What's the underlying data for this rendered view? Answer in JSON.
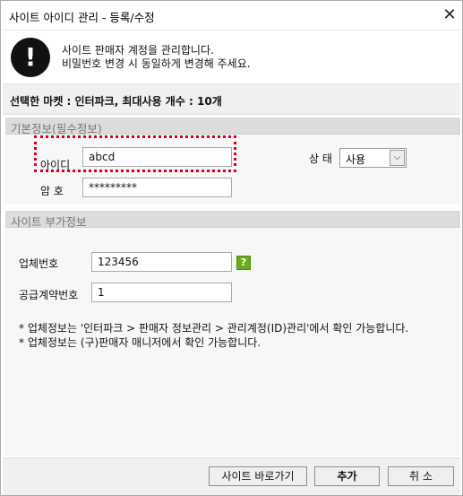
{
  "window": {
    "title": "사이트 아이디 관리 - 등록/수정"
  },
  "notice": {
    "icon": "exclamation-icon",
    "line1": "사이트 판매자 계정을 관리합니다.",
    "line2": "비밀번호 변경 시 동일하게 변경해 주세요."
  },
  "market": {
    "text": "선택한 마켓 : 인터파크, 최대사용 개수 : 10개"
  },
  "basic": {
    "header": "기본정보(필수정보)",
    "id_label": "아이디",
    "id_value": "abcd",
    "pw_label": "암  호",
    "pw_value": "*********",
    "status_label": "상 태",
    "status_value": "사용"
  },
  "extra": {
    "header": "사이트 부가정보",
    "company_label": "업체번호",
    "company_value": "123456",
    "help_glyph": "?",
    "contract_label": "공급계약번호",
    "contract_value": "1",
    "note1": "* 업체정보는 '인터파크 > 판매자 정보관리 > 관리계정(ID)관리'에서 확인 가능합니다.",
    "note2": "* 업체정보는 (구)판매자 매니저에서 확인 가능합니다."
  },
  "buttons": {
    "goto_site": "사이트 바로가기",
    "add": "추가",
    "cancel": "취 소"
  }
}
